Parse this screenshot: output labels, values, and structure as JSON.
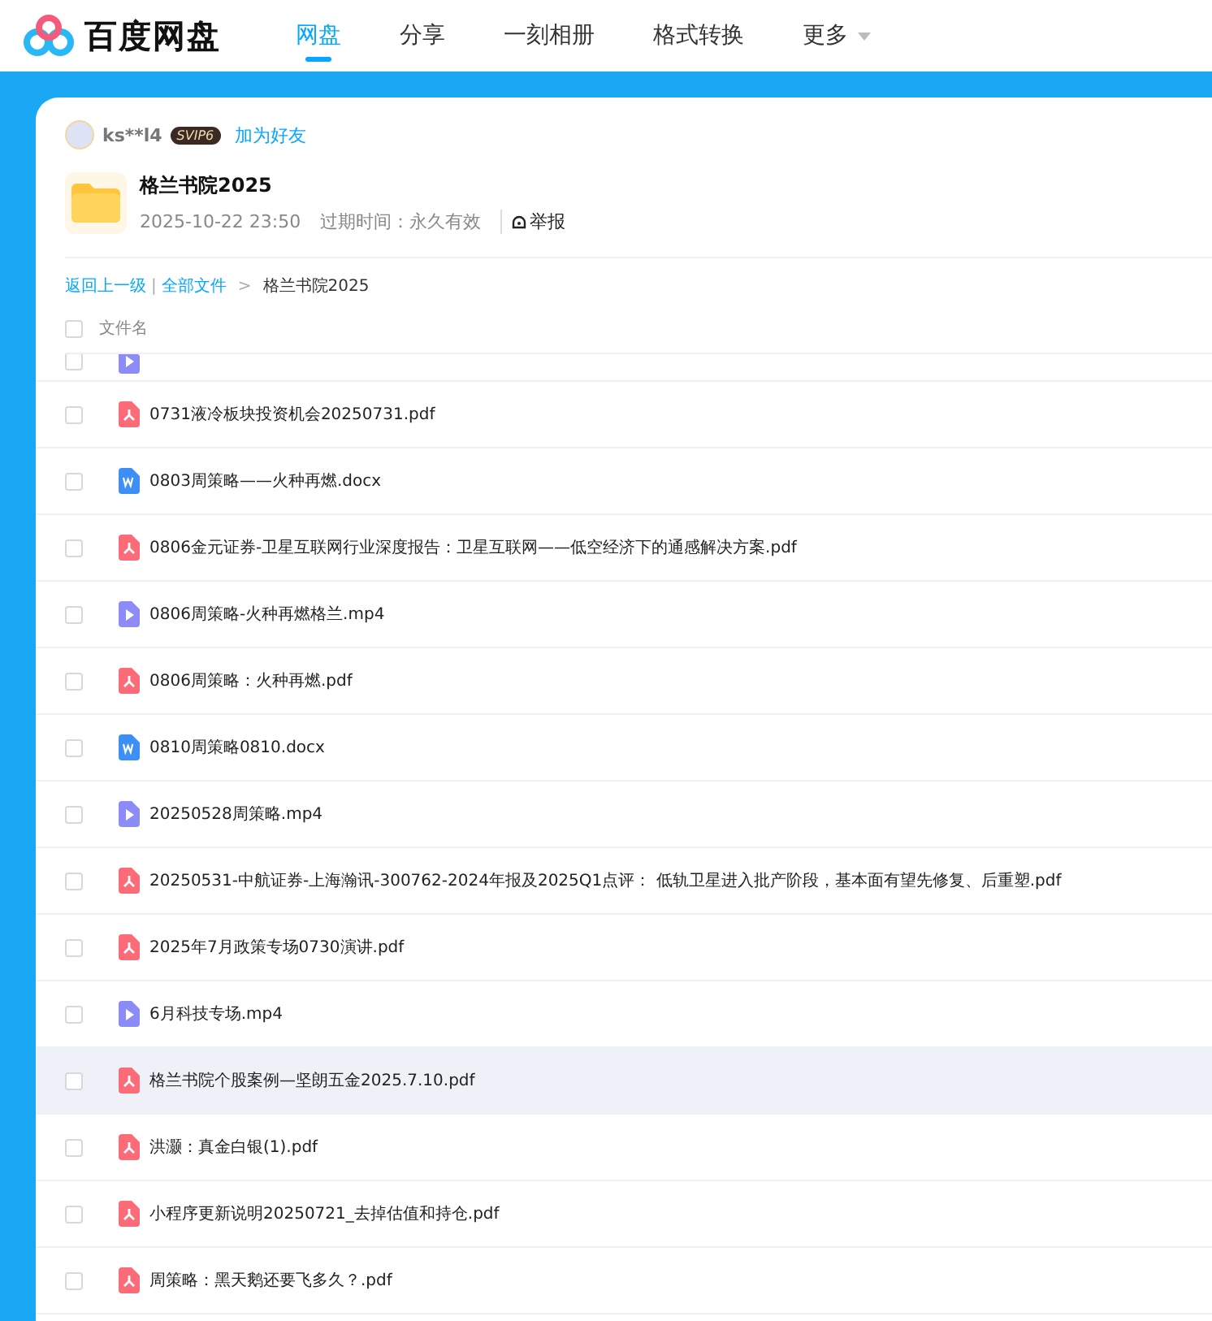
{
  "logo": {
    "text": "百度网盘"
  },
  "nav": [
    {
      "label": "网盘",
      "selected": true,
      "dropdown": false
    },
    {
      "label": "分享",
      "selected": false,
      "dropdown": false
    },
    {
      "label": "一刻相册",
      "selected": false,
      "dropdown": false
    },
    {
      "label": "格式转换",
      "selected": false,
      "dropdown": false
    },
    {
      "label": "更多",
      "selected": false,
      "dropdown": true
    }
  ],
  "sharer": {
    "name": "ks**l4",
    "badge": "SVIP6",
    "add_friend": "加为好友"
  },
  "folder": {
    "title": "格兰书院2025",
    "date": "2025-10-22 23:50",
    "expiry": "过期时间：永久有效",
    "report": "举报"
  },
  "breadcrumb": {
    "back": "返回上一级",
    "all": "全部文件",
    "divider": "|",
    "separator": ">",
    "current": "格兰书院2025"
  },
  "table": {
    "header": "文件名",
    "header_checked": false,
    "rows": [
      {
        "kind": "video",
        "partial": true,
        "checked": false,
        "hovered": false
      },
      {
        "kind": "pdf",
        "name": "0731液冷板块投资机会20250731.pdf",
        "checked": false,
        "hovered": false
      },
      {
        "kind": "doc",
        "name": "0803周策略——火种再燃.docx",
        "checked": false,
        "hovered": false
      },
      {
        "kind": "pdf",
        "name": "0806金元证券-卫星互联网行业深度报告：卫星互联网——低空经济下的通感解决方案.pdf",
        "checked": false,
        "hovered": false
      },
      {
        "kind": "video",
        "name": "0806周策略-火种再燃格兰.mp4",
        "checked": false,
        "hovered": false
      },
      {
        "kind": "pdf",
        "name": "0806周策略：火种再燃.pdf",
        "checked": false,
        "hovered": false
      },
      {
        "kind": "doc",
        "name": "0810周策略0810.docx",
        "checked": false,
        "hovered": false
      },
      {
        "kind": "video",
        "name": "20250528周策略.mp4",
        "checked": false,
        "hovered": false
      },
      {
        "kind": "pdf",
        "name": "20250531-中航证券-上海瀚讯-300762-2024年报及2025Q1点评： 低轨卫星进入批产阶段，基本面有望先修复、后重塑.pdf",
        "checked": false,
        "hovered": false
      },
      {
        "kind": "pdf",
        "name": "2025年7月政策专场0730演讲.pdf",
        "checked": false,
        "hovered": false
      },
      {
        "kind": "video",
        "name": "6月科技专场.mp4",
        "checked": false,
        "hovered": false
      },
      {
        "kind": "pdf",
        "name": "格兰书院个股案例—坚朗五金2025.7.10.pdf",
        "checked": false,
        "hovered": true
      },
      {
        "kind": "pdf",
        "name": "洪灏：真金白银(1).pdf",
        "checked": false,
        "hovered": false
      },
      {
        "kind": "pdf",
        "name": "小程序更新说明20250721_去掉估值和持仓.pdf",
        "checked": false,
        "hovered": false
      },
      {
        "kind": "pdf",
        "name": "周策略：黑天鹅还要飞多久？.pdf",
        "checked": false,
        "hovered": false
      }
    ]
  }
}
